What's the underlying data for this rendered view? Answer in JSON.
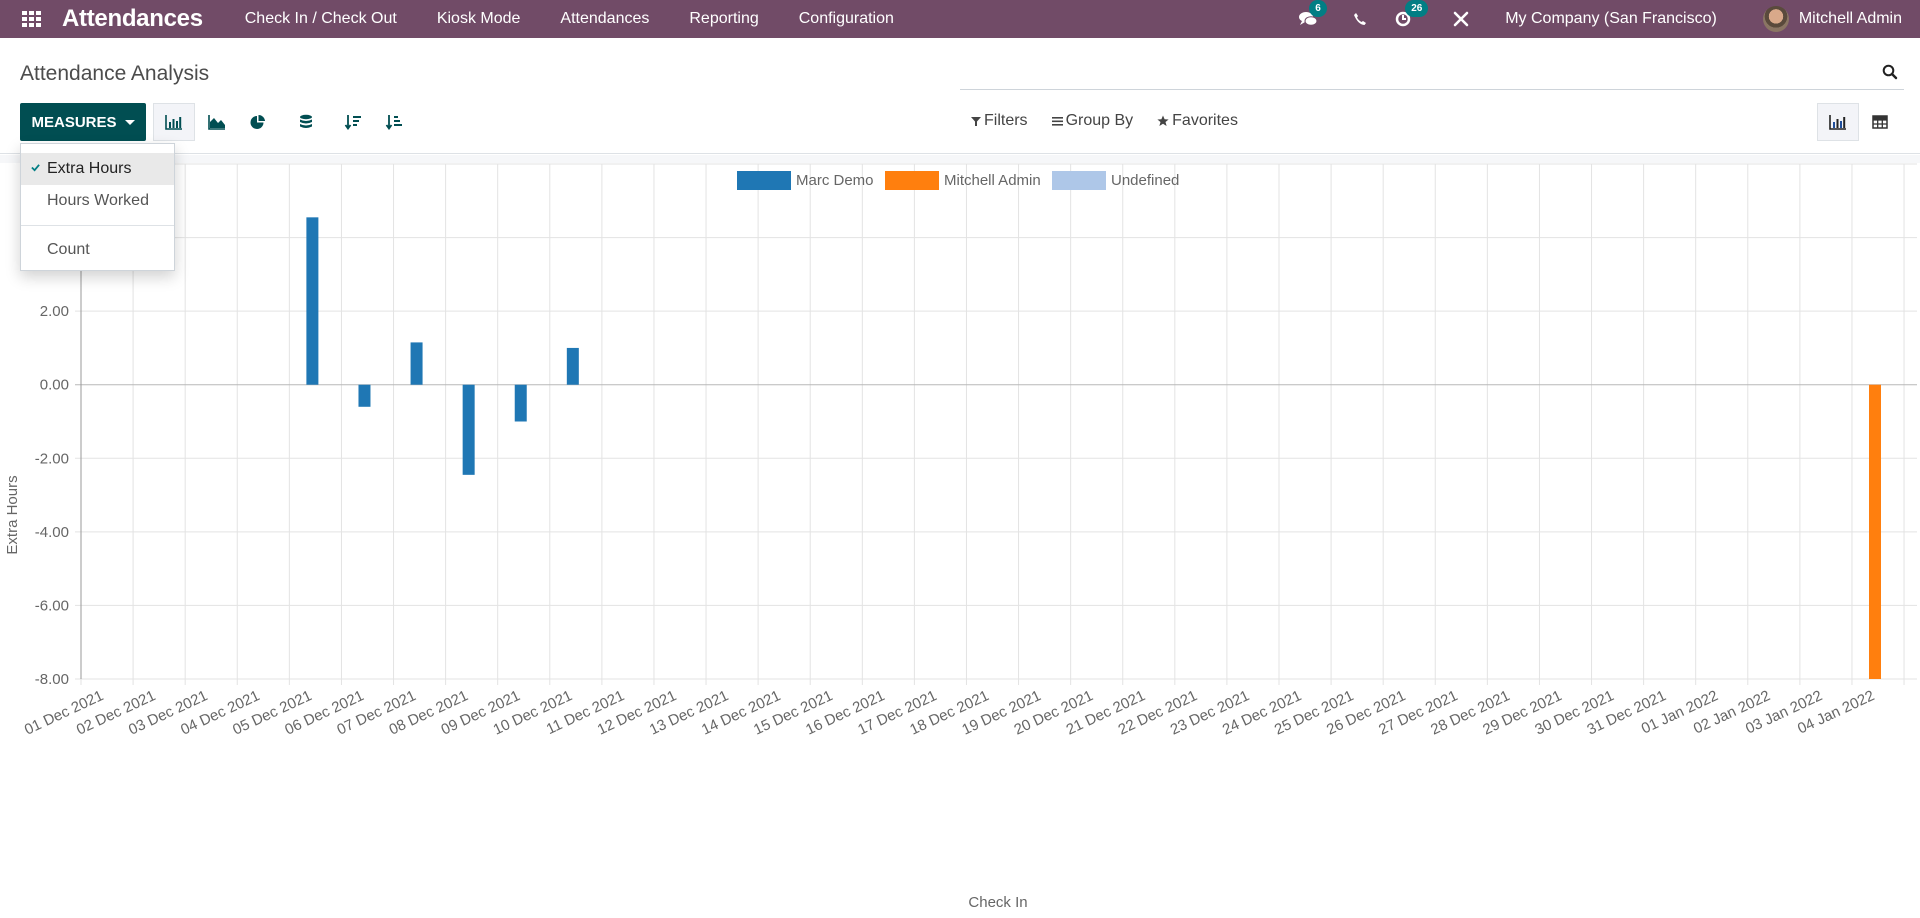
{
  "navbar": {
    "app_name": "Attendances",
    "menu": [
      "Check In / Check Out",
      "Kiosk Mode",
      "Attendances",
      "Reporting",
      "Configuration"
    ],
    "messages_badge": "6",
    "activities_badge": "26",
    "company": "My Company (San Francisco)",
    "user": "Mitchell Admin"
  },
  "control_panel": {
    "title": "Attendance Analysis",
    "measures_label": "MEASURES",
    "filters_label": "Filters",
    "group_by_label": "Group By",
    "favorites_label": "Favorites"
  },
  "measures_dropdown": {
    "items": [
      {
        "label": "Extra Hours",
        "selected": true
      },
      {
        "label": "Hours Worked",
        "selected": false
      }
    ],
    "extra_items": [
      {
        "label": "Count",
        "selected": false
      }
    ]
  },
  "colors": {
    "navbar": "#714b67",
    "primary": "#014e52",
    "badge": "#017e84"
  },
  "chart_data": {
    "type": "bar",
    "title": "",
    "xlabel": "Check In",
    "ylabel": "Extra Hours",
    "ylim": [
      -8,
      6
    ],
    "yticks": [
      -8,
      -6,
      -4,
      -2,
      0,
      2,
      4
    ],
    "ytick_format": "0.00",
    "grid": true,
    "legend_position": "top-center",
    "categories": [
      "01 Dec 2021",
      "02 Dec 2021",
      "03 Dec 2021",
      "04 Dec 2021",
      "05 Dec 2021",
      "06 Dec 2021",
      "07 Dec 2021",
      "08 Dec 2021",
      "09 Dec 2021",
      "10 Dec 2021",
      "11 Dec 2021",
      "12 Dec 2021",
      "13 Dec 2021",
      "14 Dec 2021",
      "15 Dec 2021",
      "16 Dec 2021",
      "17 Dec 2021",
      "18 Dec 2021",
      "19 Dec 2021",
      "20 Dec 2021",
      "21 Dec 2021",
      "22 Dec 2021",
      "23 Dec 2021",
      "24 Dec 2021",
      "25 Dec 2021",
      "26 Dec 2021",
      "27 Dec 2021",
      "28 Dec 2021",
      "29 Dec 2021",
      "30 Dec 2021",
      "31 Dec 2021",
      "01 Jan 2022",
      "02 Jan 2022",
      "03 Jan 2022",
      "04 Jan 2022"
    ],
    "series": [
      {
        "name": "Marc Demo",
        "color": "#1f77b4",
        "values": [
          0,
          0,
          0,
          0,
          4.55,
          -0.6,
          1.15,
          -2.45,
          -1.0,
          1.0,
          0,
          0,
          0,
          0,
          0,
          0,
          0,
          0,
          0,
          0,
          0,
          0,
          0,
          0,
          0,
          0,
          0,
          0,
          0,
          0,
          0,
          0,
          0,
          0,
          0
        ]
      },
      {
        "name": "Mitchell Admin",
        "color": "#ff7f0e",
        "values": [
          0,
          0,
          0,
          0,
          0,
          0,
          0,
          0,
          0,
          0,
          0,
          0,
          0,
          0,
          0,
          0,
          0,
          0,
          0,
          0,
          0,
          0,
          0,
          0,
          0,
          0,
          0,
          0,
          0,
          0,
          0,
          0,
          0,
          0,
          -8.0
        ]
      },
      {
        "name": "Undefined",
        "color": "#aec7e8",
        "values": [
          0,
          0,
          0,
          0,
          0,
          0,
          0,
          0,
          0,
          0,
          0,
          0,
          0,
          0,
          0,
          0,
          0,
          0,
          0,
          0,
          0,
          0,
          0,
          0,
          0,
          0,
          0,
          0,
          0,
          0,
          0,
          0,
          0,
          0,
          0
        ]
      }
    ]
  }
}
